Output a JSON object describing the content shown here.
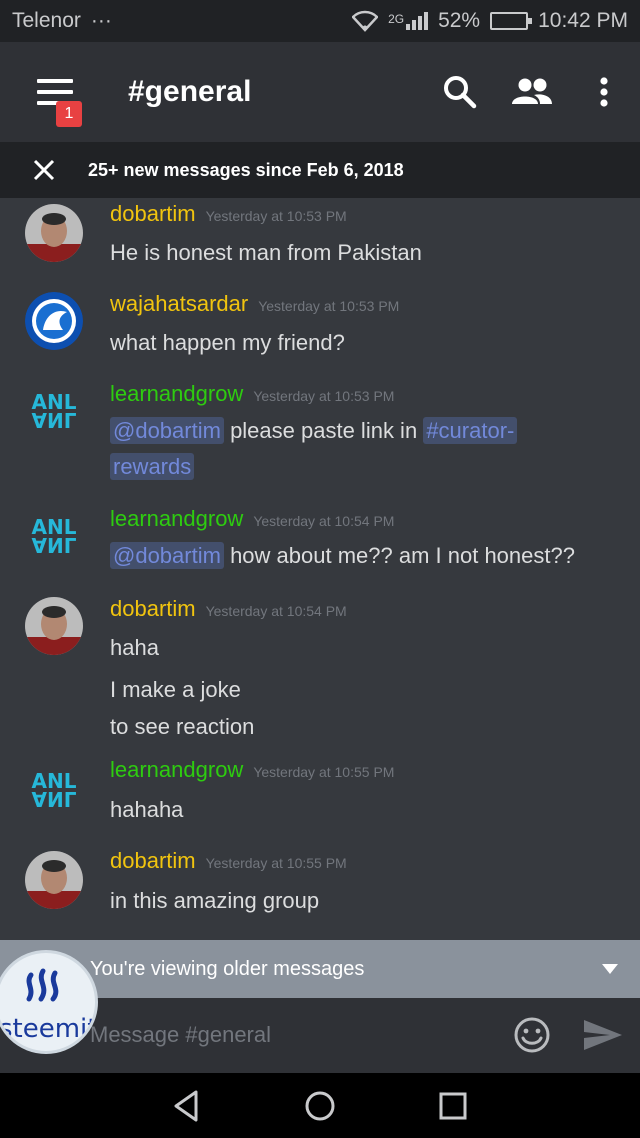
{
  "status_bar": {
    "carrier": "Telenor",
    "dots": "···",
    "network": "2G",
    "battery": "52%",
    "battery_level": 0.52,
    "time": "10:42 PM"
  },
  "toolbar": {
    "notification_count": "1",
    "channel_name": "#general"
  },
  "new_messages_bar": {
    "text": "25+ new messages since Feb 6, 2018"
  },
  "messages": [
    {
      "username": "dobartim",
      "timestamp": "Yesterday at 10:53 PM",
      "lines": [
        "He is honest man from Pakistan"
      ]
    },
    {
      "username": "wajahatsardar",
      "timestamp": "Yesterday at 10:53 PM",
      "lines": [
        "what happen my friend?"
      ]
    },
    {
      "username": "learnandgrow",
      "timestamp": "Yesterday at 10:53 PM",
      "mention": "@dobartim",
      "text": "please paste link in",
      "channel_mention_1": "#curator-",
      "channel_mention_2": "rewards"
    },
    {
      "username": "learnandgrow",
      "timestamp": "Yesterday at 10:54 PM",
      "mention": "@dobartim",
      "text": "how about me?? am I not honest??"
    },
    {
      "username": "dobartim",
      "timestamp": "Yesterday at 10:54 PM",
      "lines": [
        "haha",
        "I make a joke",
        "to see reaction"
      ]
    },
    {
      "username": "learnandgrow",
      "timestamp": "Yesterday at 10:55 PM",
      "lines": [
        "hahaha"
      ]
    },
    {
      "username": "dobartim",
      "timestamp": "Yesterday at 10:55 PM",
      "lines": [
        "in this amazing group"
      ]
    }
  ],
  "older_bar": {
    "text": "You're viewing older messages"
  },
  "composer": {
    "placeholder": "Message #general"
  },
  "watermark": {
    "text": "steemit"
  },
  "colors": {
    "username_yellow": "#f1c40f",
    "username_green": "#2ecc10",
    "mention": "#7289da",
    "badge": "#e84142"
  }
}
